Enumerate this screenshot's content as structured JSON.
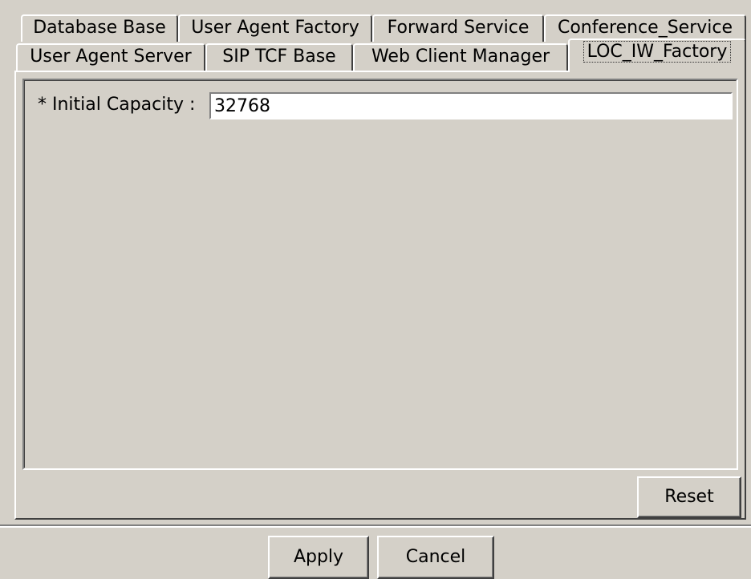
{
  "tabs": {
    "row1": [
      {
        "label": "Database Base"
      },
      {
        "label": "User Agent Factory"
      },
      {
        "label": "Forward Service"
      },
      {
        "label": "Conference_Service"
      }
    ],
    "row2": [
      {
        "label": "User Agent Server"
      },
      {
        "label": "SIP TCF Base"
      },
      {
        "label": "Web Client Manager"
      },
      {
        "label": "LOC_IW_Factory",
        "selected": true
      }
    ]
  },
  "form": {
    "initial_capacity_label": "* Initial Capacity :",
    "initial_capacity_value": "32768"
  },
  "buttons": {
    "reset": "Reset",
    "apply": "Apply",
    "cancel": "Cancel"
  }
}
